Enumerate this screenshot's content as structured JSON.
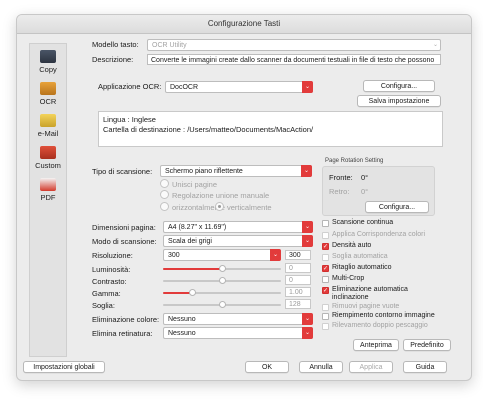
{
  "window": {
    "title": "Configurazione Tasti"
  },
  "sidebar": {
    "items": [
      {
        "label": "Copy",
        "icon": "copy-icon"
      },
      {
        "label": "OCR",
        "icon": "ocr-icon"
      },
      {
        "label": "e-Mail",
        "icon": "email-icon"
      },
      {
        "label": "Custom",
        "icon": "custom-icon"
      },
      {
        "label": "PDF",
        "icon": "pdf-icon"
      }
    ]
  },
  "header": {
    "model_label": "Modello tasto:",
    "model_value": "OCR Utility",
    "description_label": "Descrizione:",
    "description_value": "Converte le immagini create dallo scanner da documenti testuali in file di testo che possono"
  },
  "app": {
    "ocr_label": "Applicazione OCR:",
    "ocr_value": "DocOCR",
    "configure_label": "Configura...",
    "save_setting_label": "Salva impostazione",
    "info_line1": "Lingua : Inglese",
    "info_line2": "Cartella di destinazione : /Users/matteo/Documents/MacAction/"
  },
  "scan": {
    "type_label": "Tipo di scansione:",
    "type_value": "Schermo piano riflettente",
    "merge_pages": "Unisci pagine",
    "merge_setting": "Regolazione unione manuale",
    "horizontal": "orizzontalmente",
    "vertical": "verticalmente"
  },
  "rotation": {
    "title": "Page Rotation Setting",
    "front_label": "Fronte:",
    "front_value": "0°",
    "back_label": "Retro:",
    "back_value": "0°",
    "configure_label": "Configura..."
  },
  "settings": {
    "page_size_label": "Dimensioni pagina:",
    "page_size_value": "A4 (8.27\" x 11.69\")",
    "scan_mode_label": "Modo di scansione:",
    "scan_mode_value": "Scala dei grigi",
    "resolution_label": "Risoluzione:",
    "resolution_value": "300",
    "resolution_box": "300",
    "brightness_label": "Luminosità:",
    "brightness_value": "0",
    "contrast_label": "Contrasto:",
    "contrast_value": "0",
    "gamma_label": "Gamma:",
    "gamma_value": "1.00",
    "threshold_label": "Soglia:",
    "threshold_value": "128",
    "color_removal_label": "Eliminazione colore:",
    "color_removal_value": "Nessuno",
    "screen_removal_label": "Elimina retinatura:",
    "screen_removal_value": "Nessuno"
  },
  "sliders": {
    "brightness": 0.5,
    "contrast": 0.5,
    "gamma": 0.25,
    "threshold": 0.5
  },
  "options": [
    {
      "label": "Scansione continua",
      "checked": false,
      "enabled": true
    },
    {
      "label": "Applica Corrispondenza colori",
      "checked": false,
      "enabled": false
    },
    {
      "label": "Densità auto",
      "checked": true,
      "enabled": true
    },
    {
      "label": "Soglia automatica",
      "checked": false,
      "enabled": false
    },
    {
      "label": "Ritaglio automatico",
      "checked": true,
      "enabled": true
    },
    {
      "label": "Multi-Crop",
      "checked": false,
      "enabled": true
    },
    {
      "label": "Eliminazione automatica inclinazione",
      "checked": true,
      "enabled": true
    },
    {
      "label": "Rimuovi pagine vuote",
      "checked": false,
      "enabled": false
    },
    {
      "label": "Riempimento contorno immagine",
      "checked": false,
      "enabled": true
    },
    {
      "label": "Rilevamento doppio pescaggio",
      "checked": false,
      "enabled": false
    }
  ],
  "buttons": {
    "preview": "Anteprima",
    "defaults": "Predefinito",
    "global_settings": "Impostazioni globali",
    "ok": "OK",
    "cancel": "Annulla",
    "apply": "Applica",
    "help": "Guida"
  },
  "colors": {
    "accent": "#e23b3b",
    "window_bg": "#ececec"
  }
}
